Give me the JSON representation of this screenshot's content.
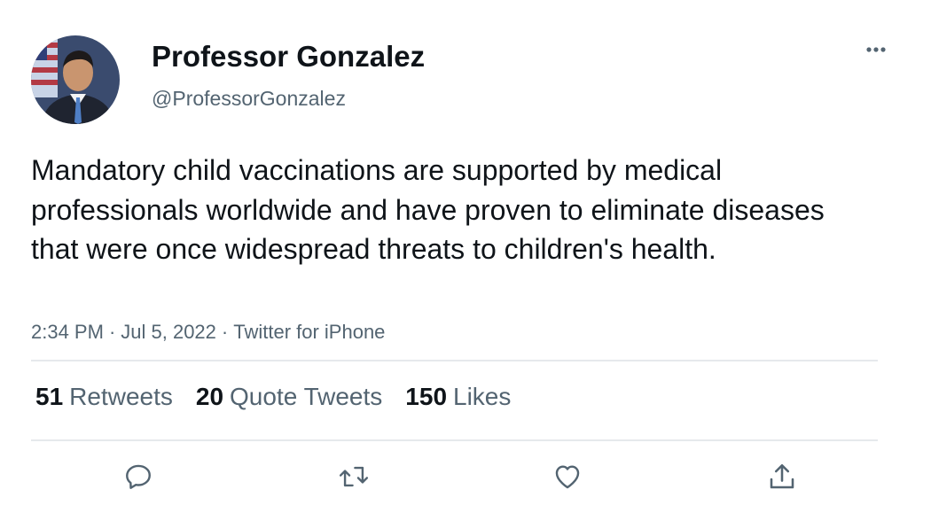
{
  "tweet": {
    "display_name": "Professor Gonzalez",
    "handle": "@ProfessorGonzalez",
    "text": "Mandatory child vaccinations are supported by medical professionals worldwide and have proven to eliminate diseases that were once widespread threats to children's health.",
    "time": "2:34 PM",
    "date": "Jul 5, 2022",
    "source": "Twitter for iPhone",
    "separator": "·"
  },
  "stats": {
    "retweets_count": "51",
    "retweets_label": "Retweets",
    "quotes_count": "20",
    "quotes_label": "Quote Tweets",
    "likes_count": "150",
    "likes_label": "Likes"
  },
  "icons": {
    "more": "more-horizontal-icon",
    "reply": "reply-icon",
    "retweet": "retweet-icon",
    "like": "heart-icon",
    "share": "share-icon"
  },
  "colors": {
    "text_primary": "#0f1419",
    "text_secondary": "#536471",
    "divider": "#e6e9ec",
    "icon": "#536471"
  }
}
